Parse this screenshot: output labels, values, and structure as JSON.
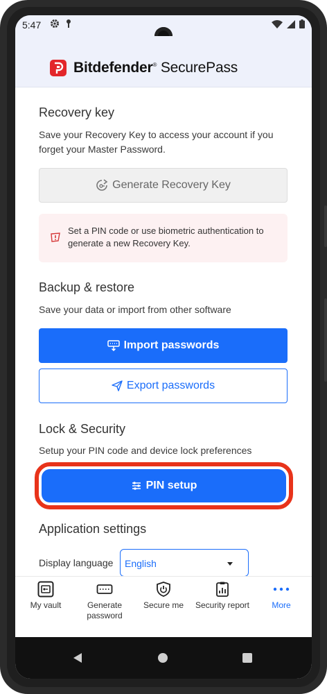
{
  "status": {
    "time": "5:47"
  },
  "brand": {
    "name_bold": "Bitdefender",
    "name_light": "SecurePass"
  },
  "recovery": {
    "title": "Recovery key",
    "description": "Save your Recovery Key to access your account if you forget your Master Password.",
    "generate_label": "Generate Recovery Key",
    "alert_text": "Set a PIN code or use biometric authentication to generate a new Recovery Key."
  },
  "backup": {
    "title": "Backup & restore",
    "description": "Save your data or import from other software",
    "import_label": "Import passwords",
    "export_label": "Export passwords"
  },
  "lock": {
    "title": "Lock & Security",
    "description": "Setup your PIN code and device lock preferences",
    "pin_label": "PIN setup"
  },
  "app_settings": {
    "title": "Application settings",
    "language_label": "Display language",
    "language_value": "English"
  },
  "bottom_nav": {
    "items": [
      {
        "label": "My vault",
        "icon": "vault-icon"
      },
      {
        "label": "Generate password",
        "icon": "keyboard-icon"
      },
      {
        "label": "Secure me",
        "icon": "shield-icon"
      },
      {
        "label": "Security report",
        "icon": "clipboard-chart-icon"
      },
      {
        "label": "More",
        "icon": "more-dots-icon"
      }
    ]
  },
  "colors": {
    "accent": "#1a6dfa",
    "highlight": "#e8331a",
    "brand_red": "#e3262a"
  }
}
